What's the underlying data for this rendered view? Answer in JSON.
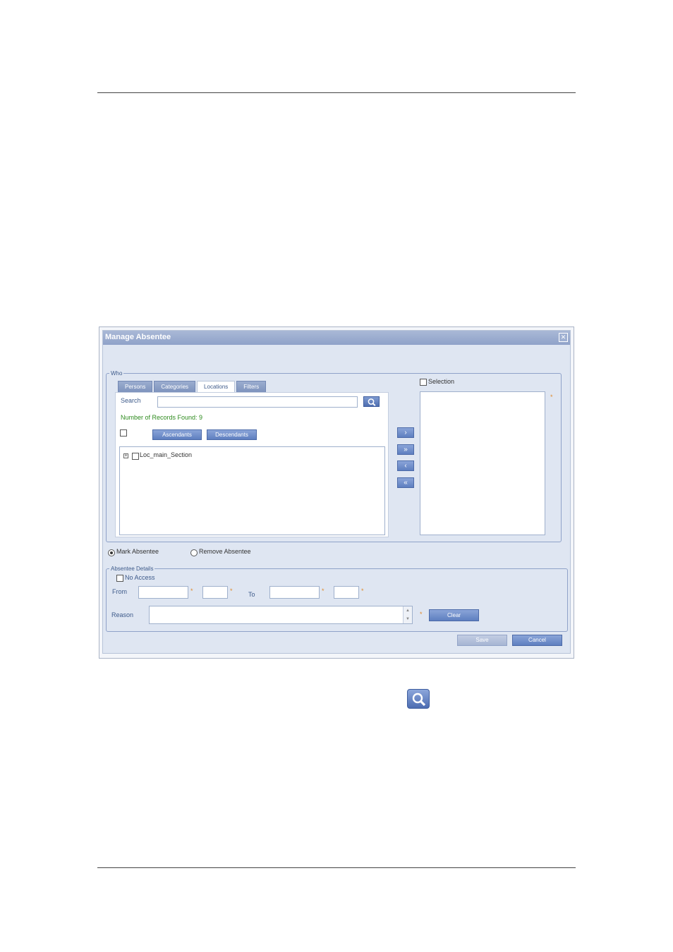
{
  "dialog": {
    "title": "Manage Absentee",
    "close_glyph": "✕"
  },
  "who": {
    "legend": "Who",
    "tabs": [
      "Persons",
      "Categories",
      "Locations",
      "Filters"
    ],
    "active_tab": "Locations",
    "search_label": "Search",
    "search_value": "",
    "records_found": "Number of Records Found: 9",
    "ascendants_label": "Ascendants",
    "descendants_label": "Descendants",
    "tree": {
      "expander_glyph": "+",
      "node_label": "Loc_main_Section"
    },
    "move_buttons": [
      "›",
      "»",
      "‹",
      "«"
    ]
  },
  "selection": {
    "label": "Selection",
    "required_mark": "*"
  },
  "mode": {
    "mark_label": "Mark Absentee",
    "remove_label": "Remove Absentee",
    "selected": "Mark Absentee"
  },
  "details": {
    "legend": "Absentee Details",
    "no_access_label": "No Access",
    "from_label": "From",
    "to_label": "To",
    "reason_label": "Reason",
    "required_mark": "*",
    "clear_label": "Clear",
    "scroll_up": "▲",
    "scroll_down": "▼"
  },
  "footer": {
    "save_label": "Save",
    "cancel_label": "Cancel"
  },
  "icons": {
    "search": "search-icon",
    "close": "close-icon"
  },
  "colors": {
    "titlebar": "#8fa2c9",
    "button_blue": "#5e7fc0",
    "records_text": "#2e8b1e",
    "required": "#e08a2b"
  }
}
